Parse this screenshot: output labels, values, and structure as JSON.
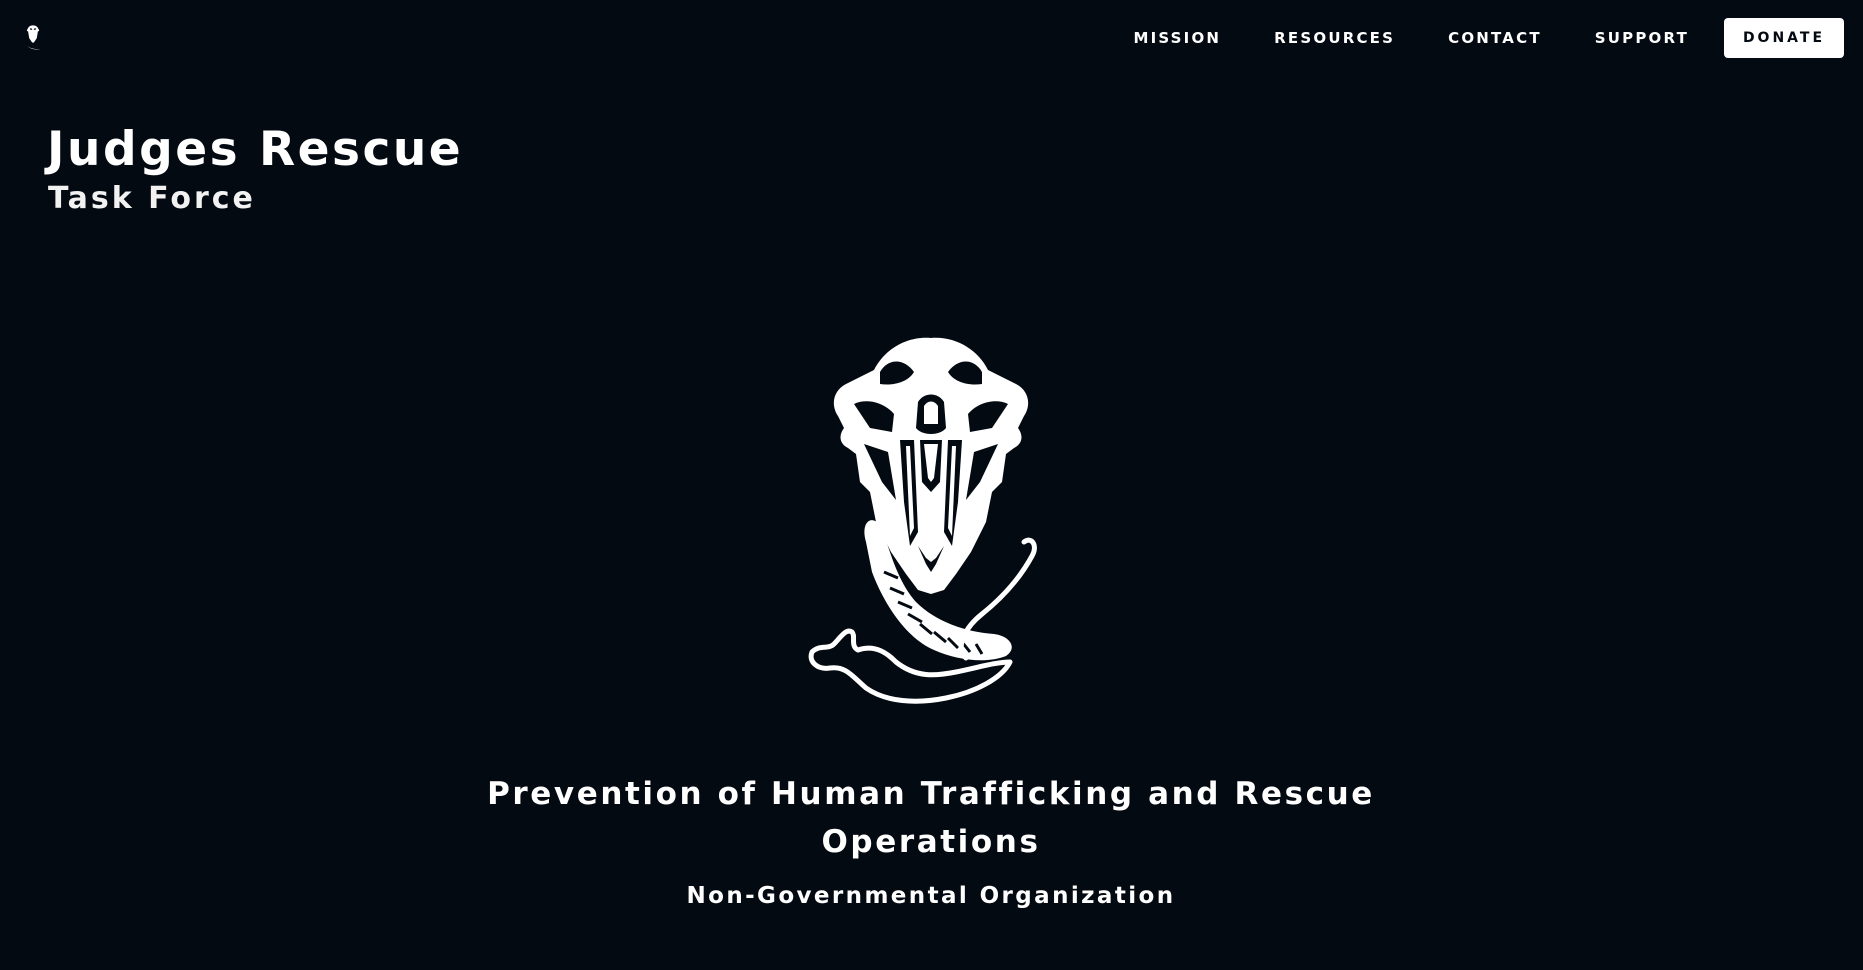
{
  "header": {
    "logo_icon": "beast-skull-logo-icon",
    "nav_links": [
      "MISSION",
      "RESOURCES",
      "CONTACT",
      "SUPPORT"
    ],
    "donate_label": "DONATE"
  },
  "brand": {
    "title": "Judges Rescue",
    "subtitle": "Task Force"
  },
  "hero": {
    "emblem_icon": "beast-skull-emblem-icon",
    "heading": "Prevention of Human Trafficking and Rescue Operations",
    "subheading": "Non-Governmental Organization"
  },
  "colors": {
    "background": "#040a12",
    "text": "#ffffff",
    "button_background": "#ffffff",
    "button_text": "#040a12"
  }
}
